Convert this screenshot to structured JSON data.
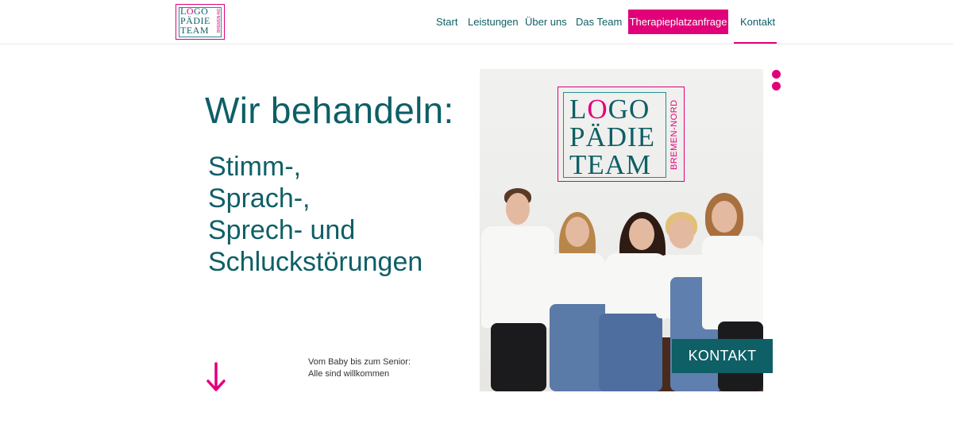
{
  "header": {
    "logo": {
      "line1": "LOGO",
      "line2": "PÄDIE",
      "line3": "TEAM",
      "side": "BREMEN-NORD"
    },
    "nav": [
      {
        "label": "Start"
      },
      {
        "label": "Leistungen"
      },
      {
        "label": "Über uns"
      },
      {
        "label": "Das Team"
      }
    ],
    "cta_label": "Therapieplatzanfrage",
    "contact_label": "Kontakt"
  },
  "hero": {
    "title": "Wir behandeln:",
    "conditions": [
      "Stimm-,",
      "Sprach-,",
      "Sprech- und",
      "Schluckstörungen"
    ],
    "tagline": [
      "Vom Baby bis zum Senior:",
      "Alle sind willkommen"
    ]
  },
  "photo": {
    "logo": {
      "line1": "LOGO",
      "line2": "PÄDIE",
      "line3": "TEAM",
      "side": "BREMEN-NORD"
    }
  },
  "kontakt_button": "KONTAKT",
  "colors": {
    "brand_teal": "#0e5f66",
    "brand_pink": "#e2007a"
  },
  "icons": {
    "scroll_down": "arrow-down-icon",
    "carousel_dots": "dots-icon"
  }
}
